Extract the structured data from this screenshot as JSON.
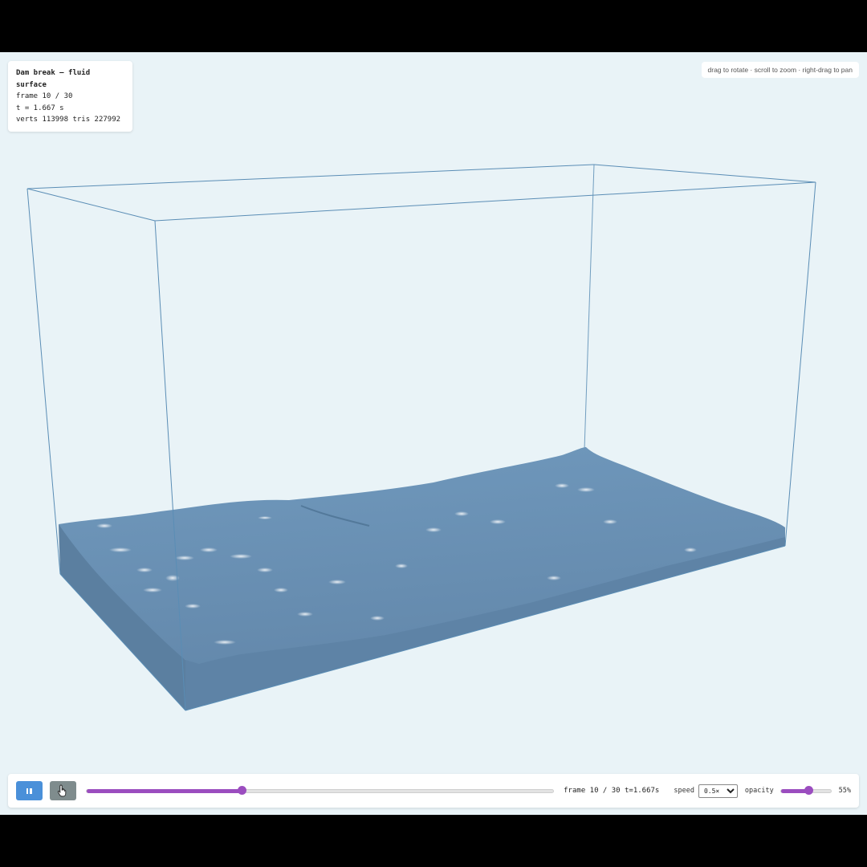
{
  "info": {
    "title": "Dam break — fluid surface",
    "frame_text": "frame 10 / 30",
    "time_text": "t = 1.667 s",
    "mesh_text": "verts 113998 tris 227992"
  },
  "hint": "drag to rotate · scroll to zoom · right-drag to pan",
  "controls": {
    "pause_icon": "pause-icon",
    "step_icon": "cursor-hand-icon",
    "frame_progress": 0.333,
    "frame_label": "frame 10 / 30 t=1.667s",
    "speed_label": "speed",
    "speed_value": "0.5×",
    "opacity_label": "opacity",
    "opacity_fraction": 0.55,
    "opacity_value": "55%"
  },
  "colors": {
    "viewport_bg": "#e9f3f7",
    "tank_edge": "#5a8db5",
    "water": "#6a91b4",
    "accent": "#9b4dbf",
    "pause_button": "#4a90d9",
    "step_button": "#7f8c8d"
  }
}
